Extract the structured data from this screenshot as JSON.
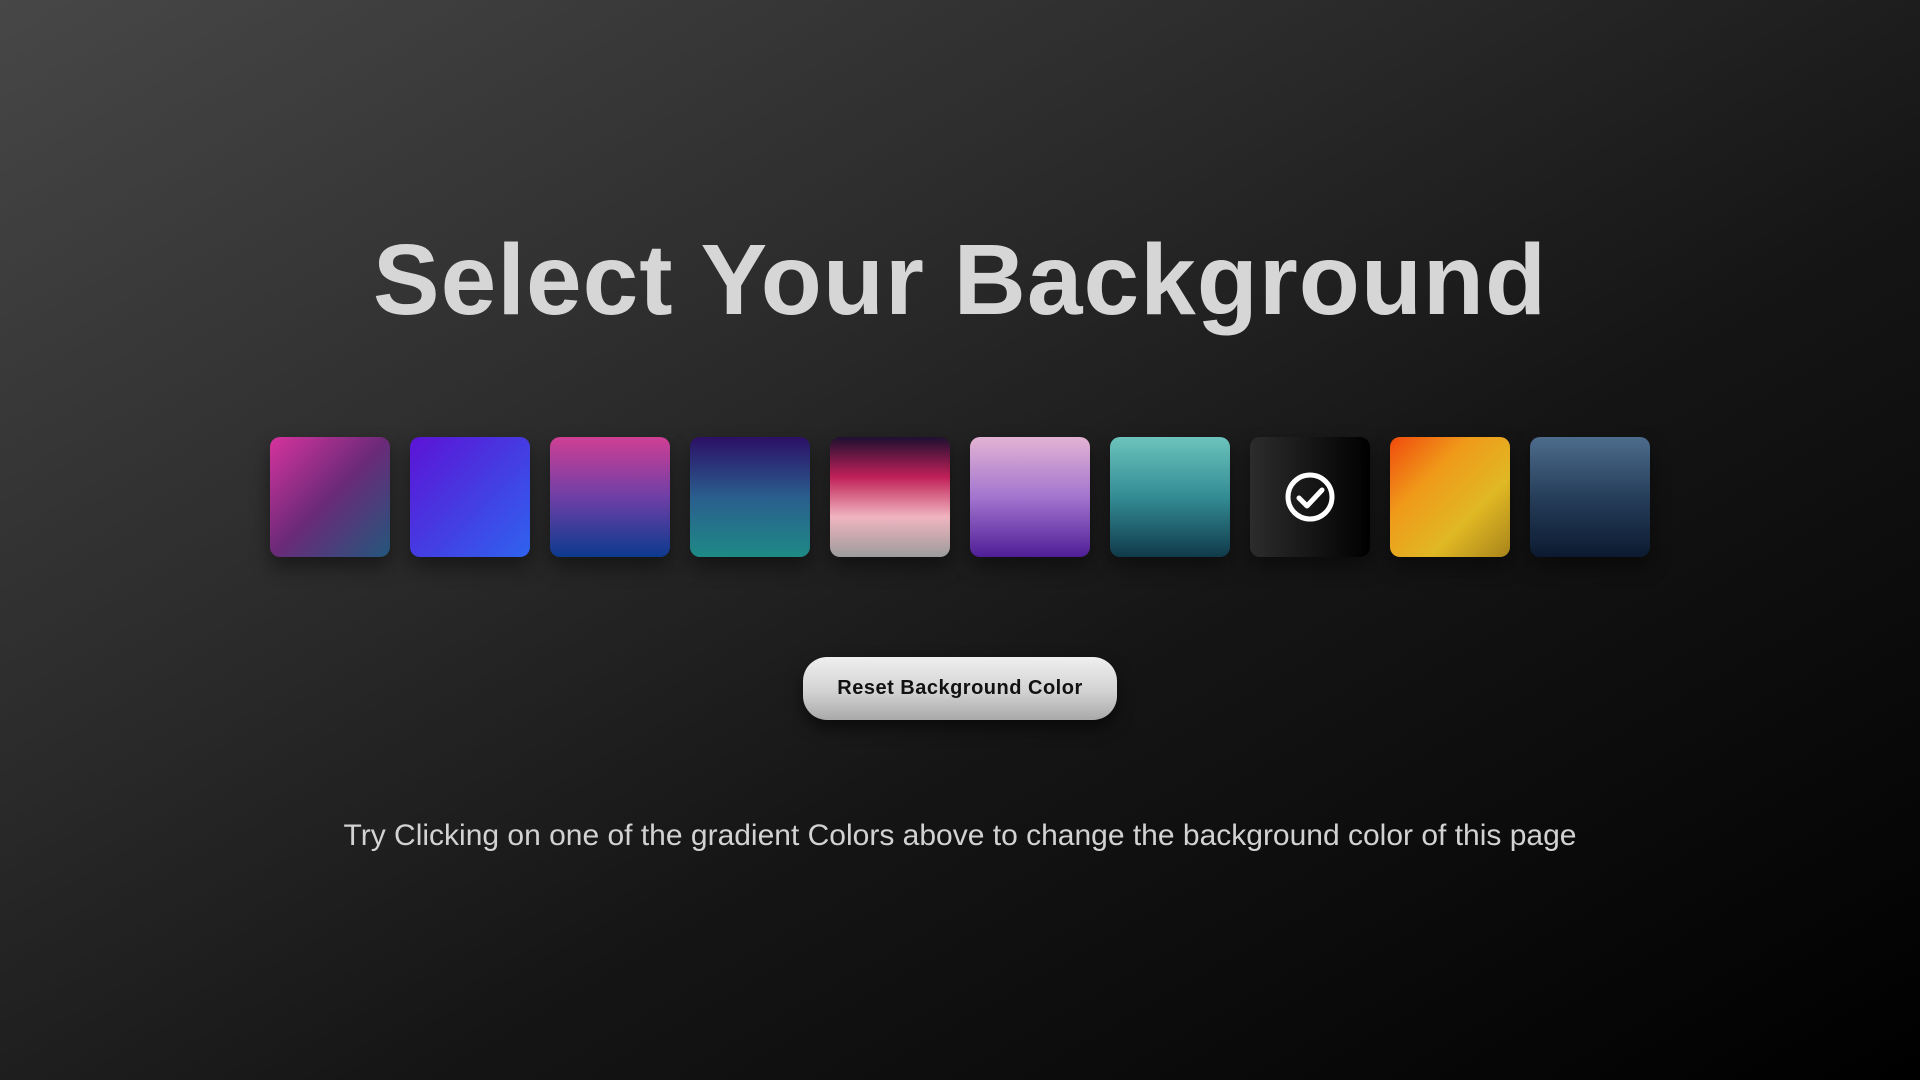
{
  "page": {
    "title": "Select Your Background",
    "hint": "Try Clicking on one of the gradient Colors above to change the background color of this page"
  },
  "reset_button": {
    "label": "Reset Background Color"
  },
  "swatches": [
    {
      "name": "swatch-magenta-teal",
      "colors": [
        "#d6339e",
        "#6a2a78",
        "#23577c"
      ],
      "selected": false
    },
    {
      "name": "swatch-violet-blue",
      "colors": [
        "#5c13d6",
        "#2f63ee"
      ],
      "selected": false
    },
    {
      "name": "swatch-pink-navy",
      "colors": [
        "#cf3f93",
        "#6e3fa6",
        "#0c3a8e"
      ],
      "selected": false
    },
    {
      "name": "swatch-indigo-teal",
      "colors": [
        "#2c0f66",
        "#2a5e8e",
        "#1e8a86"
      ],
      "selected": false
    },
    {
      "name": "swatch-dark-crimson-gray",
      "colors": [
        "#1e1030",
        "#c02058",
        "#f0b5bf",
        "#9c9c9c"
      ],
      "selected": false
    },
    {
      "name": "swatch-lilac-purple",
      "colors": [
        "#e3b3d3",
        "#a375cf",
        "#4f1e96"
      ],
      "selected": false
    },
    {
      "name": "swatch-aqua-deep-teal",
      "colors": [
        "#6cc3bc",
        "#338c94",
        "#103a4a"
      ],
      "selected": false
    },
    {
      "name": "swatch-charcoal-black",
      "colors": [
        "#2c2c2c",
        "#000000"
      ],
      "selected": true
    },
    {
      "name": "swatch-orange-gold",
      "colors": [
        "#f04a0c",
        "#f09a1a",
        "#e0b824",
        "#a8841a"
      ],
      "selected": false
    },
    {
      "name": "swatch-slate-navy",
      "colors": [
        "#4d6c8c",
        "#263e5a",
        "#0c1a30"
      ],
      "selected": false
    }
  ],
  "icons": {
    "selected_indicator": "check-circle-icon"
  }
}
